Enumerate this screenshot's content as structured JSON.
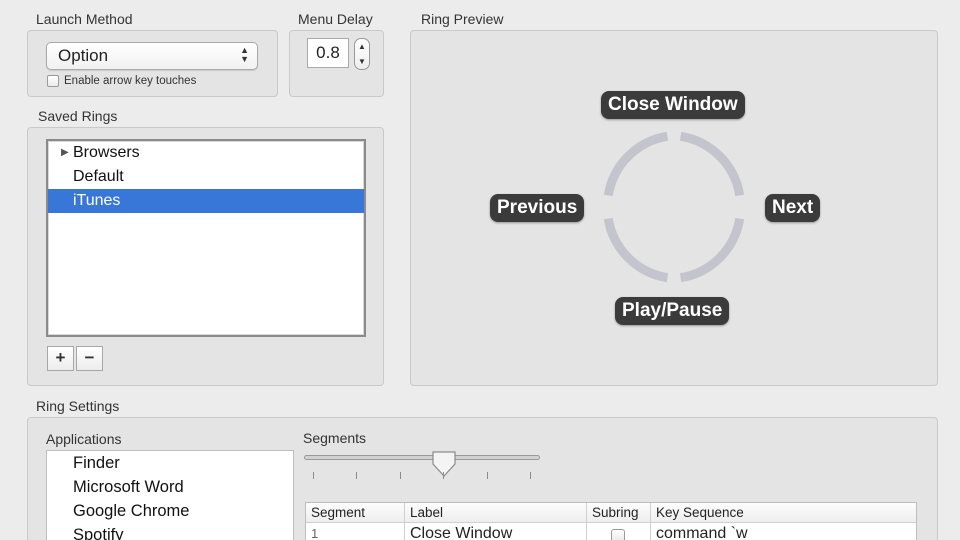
{
  "launch_method": {
    "label": "Launch Method",
    "selected": "Option",
    "checkbox_label": "Enable arrow key touches",
    "checkbox_checked": false
  },
  "menu_delay": {
    "label": "Menu Delay",
    "value": "0.8"
  },
  "saved_rings": {
    "label": "Saved Rings",
    "items": [
      {
        "label": "Browsers",
        "has_children": true
      },
      {
        "label": "Default",
        "has_children": false
      },
      {
        "label": "iTunes",
        "has_children": false,
        "selected": true
      }
    ],
    "add_label": "+",
    "remove_label": "−"
  },
  "ring_preview": {
    "label": "Ring Preview",
    "top": "Close Window",
    "left": "Previous",
    "right": "Next",
    "bottom": "Play/Pause"
  },
  "ring_settings": {
    "label": "Ring Settings",
    "applications_label": "Applications",
    "applications": [
      "Finder",
      "Microsoft Word",
      "Google Chrome",
      "Spotify"
    ],
    "segments_label": "Segments",
    "table": {
      "headers": [
        "Segment",
        "Label",
        "Subring",
        "Key Sequence"
      ],
      "rows": [
        {
          "segment": "1",
          "label": "Close Window",
          "subring": false,
          "key_sequence": "command `w"
        }
      ]
    }
  },
  "colors": {
    "selection": "#3876d8",
    "ring_label_bg": "#3b3b3b",
    "ring_stroke": "#c4c4cc"
  }
}
